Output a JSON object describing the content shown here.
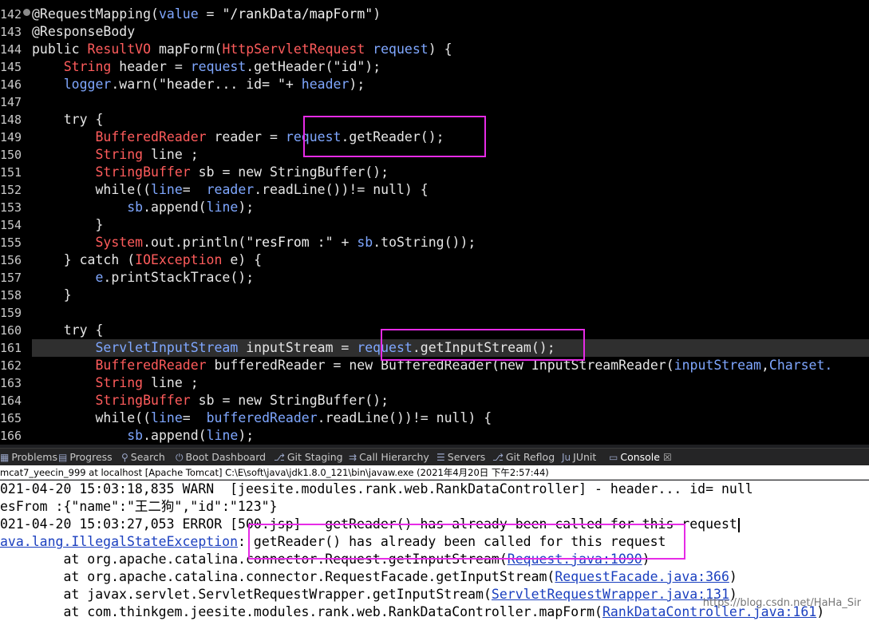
{
  "editor": {
    "lines": [
      {
        "n": "142",
        "tokens": [
          {
            "c": "k",
            "t": "@RequestMapping("
          },
          {
            "c": "v",
            "t": "value"
          },
          {
            "c": "k",
            "t": " = "
          },
          {
            "c": "s",
            "t": "\"/rankData/mapForm\""
          },
          {
            "c": "k",
            "t": ")"
          }
        ]
      },
      {
        "n": "143",
        "tokens": [
          {
            "c": "k",
            "t": "@ResponseBody"
          }
        ]
      },
      {
        "n": "144",
        "tokens": [
          {
            "c": "k",
            "t": "public "
          },
          {
            "c": "t",
            "t": "ResultVO"
          },
          {
            "c": "k",
            "t": " mapForm("
          },
          {
            "c": "t",
            "t": "HttpServletRequest"
          },
          {
            "c": "v",
            "t": " request"
          },
          {
            "c": "k",
            "t": ") {"
          }
        ]
      },
      {
        "n": "145",
        "tokens": [
          {
            "c": "k",
            "t": "    "
          },
          {
            "c": "t",
            "t": "String"
          },
          {
            "c": "k",
            "t": " header = "
          },
          {
            "c": "v",
            "t": "request"
          },
          {
            "c": "k",
            "t": ".getHeader("
          },
          {
            "c": "s",
            "t": "\"id\""
          },
          {
            "c": "k",
            "t": ");"
          }
        ]
      },
      {
        "n": "146",
        "tokens": [
          {
            "c": "k",
            "t": "    "
          },
          {
            "c": "v",
            "t": "logger"
          },
          {
            "c": "k",
            "t": ".warn("
          },
          {
            "c": "s",
            "t": "\"header... id= \""
          },
          {
            "c": "k",
            "t": "+ "
          },
          {
            "c": "v",
            "t": "header"
          },
          {
            "c": "k",
            "t": ");"
          }
        ]
      },
      {
        "n": "147",
        "tokens": []
      },
      {
        "n": "148",
        "tokens": [
          {
            "c": "k",
            "t": "    try {"
          }
        ]
      },
      {
        "n": "149",
        "tokens": [
          {
            "c": "k",
            "t": "        "
          },
          {
            "c": "t",
            "t": "BufferedReader"
          },
          {
            "c": "k",
            "t": " reader = "
          },
          {
            "c": "v",
            "t": "request"
          },
          {
            "c": "k",
            "t": ".getReader();"
          }
        ]
      },
      {
        "n": "150",
        "tokens": [
          {
            "c": "k",
            "t": "        "
          },
          {
            "c": "t",
            "t": "String"
          },
          {
            "c": "k",
            "t": " line ;"
          }
        ]
      },
      {
        "n": "151",
        "tokens": [
          {
            "c": "k",
            "t": "        "
          },
          {
            "c": "t",
            "t": "StringBuffer"
          },
          {
            "c": "k",
            "t": " sb = new StringBuffer();"
          }
        ]
      },
      {
        "n": "152",
        "tokens": [
          {
            "c": "k",
            "t": "        while(("
          },
          {
            "c": "v",
            "t": "line"
          },
          {
            "c": "k",
            "t": "=  "
          },
          {
            "c": "v",
            "t": "reader"
          },
          {
            "c": "k",
            "t": ".readLine())!= null) {"
          }
        ]
      },
      {
        "n": "153",
        "tokens": [
          {
            "c": "k",
            "t": "            "
          },
          {
            "c": "v",
            "t": "sb"
          },
          {
            "c": "k",
            "t": ".append("
          },
          {
            "c": "v",
            "t": "line"
          },
          {
            "c": "k",
            "t": ");"
          }
        ]
      },
      {
        "n": "154",
        "tokens": [
          {
            "c": "k",
            "t": "        }"
          }
        ]
      },
      {
        "n": "155",
        "tokens": [
          {
            "c": "k",
            "t": "        "
          },
          {
            "c": "t",
            "t": "System"
          },
          {
            "c": "k",
            "t": ".out.println("
          },
          {
            "c": "s",
            "t": "\"resFrom :\""
          },
          {
            "c": "k",
            "t": " + "
          },
          {
            "c": "v",
            "t": "sb"
          },
          {
            "c": "k",
            "t": ".toString());"
          }
        ]
      },
      {
        "n": "156",
        "tokens": [
          {
            "c": "k",
            "t": "    } catch ("
          },
          {
            "c": "t",
            "t": "IOException"
          },
          {
            "c": "k",
            "t": " e) {"
          }
        ]
      },
      {
        "n": "157",
        "tokens": [
          {
            "c": "k",
            "t": "        "
          },
          {
            "c": "v",
            "t": "e"
          },
          {
            "c": "k",
            "t": ".printStackTrace();"
          }
        ]
      },
      {
        "n": "158",
        "tokens": [
          {
            "c": "k",
            "t": "    }"
          }
        ]
      },
      {
        "n": "159",
        "tokens": []
      },
      {
        "n": "160",
        "tokens": [
          {
            "c": "k",
            "t": "    try {"
          }
        ]
      },
      {
        "n": "161",
        "current": true,
        "tokens": [
          {
            "c": "k",
            "t": "        "
          },
          {
            "c": "v",
            "t": "ServletInputStream"
          },
          {
            "c": "k",
            "t": " inputStream = "
          },
          {
            "c": "v",
            "t": "request"
          },
          {
            "c": "k",
            "t": ".getInputStream();"
          }
        ]
      },
      {
        "n": "162",
        "tokens": [
          {
            "c": "k",
            "t": "        "
          },
          {
            "c": "t",
            "t": "BufferedReader"
          },
          {
            "c": "k",
            "t": " bufferedReader = new BufferedReader(new InputStreamReader("
          },
          {
            "c": "v",
            "t": "inputStream"
          },
          {
            "c": "k",
            "t": ","
          },
          {
            "c": "v",
            "t": "Charset."
          }
        ]
      },
      {
        "n": "163",
        "tokens": [
          {
            "c": "k",
            "t": "        "
          },
          {
            "c": "t",
            "t": "String"
          },
          {
            "c": "k",
            "t": " line ;"
          }
        ]
      },
      {
        "n": "164",
        "tokens": [
          {
            "c": "k",
            "t": "        "
          },
          {
            "c": "t",
            "t": "StringBuffer"
          },
          {
            "c": "k",
            "t": " sb = new StringBuffer();"
          }
        ]
      },
      {
        "n": "165",
        "tokens": [
          {
            "c": "k",
            "t": "        while(("
          },
          {
            "c": "v",
            "t": "line"
          },
          {
            "c": "k",
            "t": "=  "
          },
          {
            "c": "v",
            "t": "bufferedReader"
          },
          {
            "c": "k",
            "t": ".readLine())!= null) {"
          }
        ]
      },
      {
        "n": "166",
        "tokens": [
          {
            "c": "k",
            "t": "            "
          },
          {
            "c": "v",
            "t": "sb"
          },
          {
            "c": "k",
            "t": ".append("
          },
          {
            "c": "v",
            "t": "line"
          },
          {
            "c": "k",
            "t": ");"
          }
        ]
      }
    ]
  },
  "tabs": [
    {
      "icon": "problems-icon",
      "glyph": "▦",
      "label": "Problems"
    },
    {
      "icon": "progress-icon",
      "glyph": "▤",
      "label": "Progress"
    },
    {
      "icon": "search-icon",
      "glyph": "⚲",
      "label": "Search"
    },
    {
      "icon": "boot-dashboard-icon",
      "glyph": "⏻",
      "label": "Boot Dashboard"
    },
    {
      "icon": "git-staging-icon",
      "glyph": "⎇",
      "label": "Git Staging"
    },
    {
      "icon": "call-hierarchy-icon",
      "glyph": "⇉",
      "label": "Call Hierarchy"
    },
    {
      "icon": "servers-icon",
      "glyph": "☰",
      "label": "Servers"
    },
    {
      "icon": "git-reflog-icon",
      "glyph": "⎇",
      "label": "Git Reflog"
    },
    {
      "icon": "junit-icon",
      "glyph": "Ju",
      "label": "JUnit"
    },
    {
      "icon": "console-icon",
      "glyph": "▭",
      "label": "Console",
      "active": true
    }
  ],
  "console_close": "☒",
  "status": "mcat7_yeecin_999 at localhost [Apache Tomcat] C:\\E\\soft\\java\\jdk1.8.0_121\\bin\\javaw.exe (2021年4月20日 下午2:57:44)",
  "console": {
    "line1": "021-04-20 15:03:18,835 WARN  [jeesite.modules.rank.web.RankDataController] - header... id= null",
    "line2": "esFrom :{\"name\":\"王二狗\",\"id\":\"123\"}",
    "line3": "021-04-20 15:03:27,053 ERROR [500.jsp] - getReader() has already been called for this request",
    "line4_link": "ava.lang.IllegalStateException",
    "line4_rest": ": getReader() has already been called for this request",
    "line5_pre": "        at org.apache.catalina.connector.Request.getInputStream(",
    "line5_link": "Request.java:1090",
    "line5_post": ")",
    "line6_pre": "        at org.apache.catalina.connector.RequestFacade.getInputStream(",
    "line6_link": "RequestFacade.java:366",
    "line6_post": ")",
    "line7_pre": "        at javax.servlet.ServletRequestWrapper.getInputStream(",
    "line7_link": "ServletRequestWrapper.java:131",
    "line7_post": ")",
    "line8_pre": "        at com.thinkgem.jeesite.modules.rank.web.RankDataController.mapForm(",
    "line8_link": "RankDataController.java:161",
    "line8_post": ")"
  },
  "watermark": "https://blog.csdn.net/HaHa_Sir",
  "colors": {
    "highlight": "#e62be6",
    "link": "#1a3fbf"
  }
}
